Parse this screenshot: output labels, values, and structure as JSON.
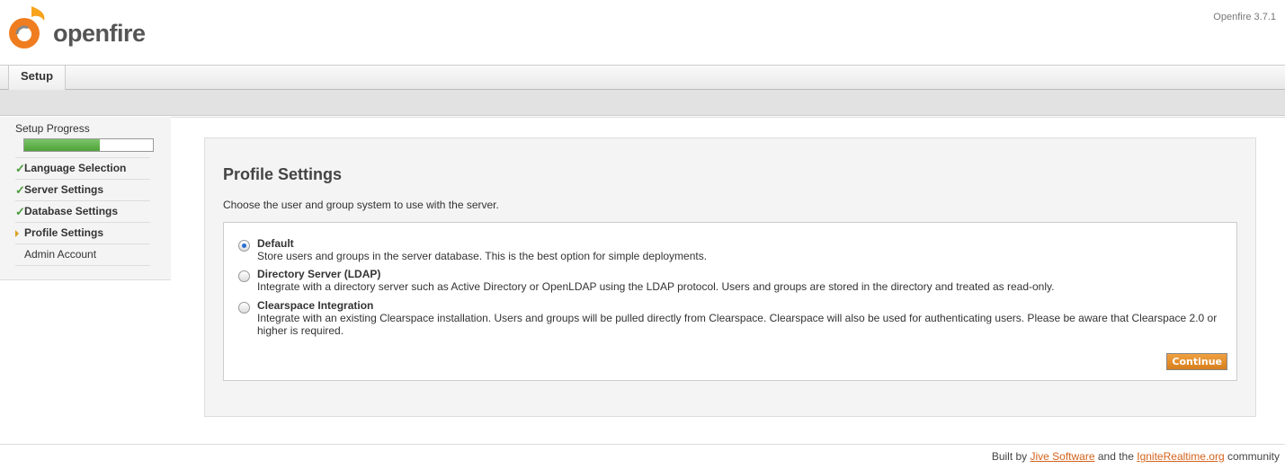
{
  "header": {
    "logo_text": "openfire",
    "version": "Openfire 3.7.1"
  },
  "tabs": [
    {
      "label": "Setup"
    }
  ],
  "sidebar": {
    "title": "Setup Progress",
    "progress_percent": 59,
    "items": [
      {
        "label": "Language Selection",
        "status": "done"
      },
      {
        "label": "Server Settings",
        "status": "done"
      },
      {
        "label": "Database Settings",
        "status": "done"
      },
      {
        "label": "Profile Settings",
        "status": "current"
      },
      {
        "label": "Admin Account",
        "status": "pending"
      }
    ]
  },
  "main": {
    "title": "Profile Settings",
    "intro": "Choose the user and group system to use with the server.",
    "options": [
      {
        "label": "Default",
        "description": "Store users and groups in the server database. This is the best option for simple deployments.",
        "selected": true
      },
      {
        "label": "Directory Server (LDAP)",
        "description": "Integrate with a directory server such as Active Directory or OpenLDAP using the LDAP protocol. Users and groups are stored in the directory and treated as read-only.",
        "selected": false
      },
      {
        "label": "Clearspace Integration",
        "description": "Integrate with an existing Clearspace installation. Users and groups will be pulled directly from Clearspace. Clearspace will also be used for authenticating users. Please be aware that Clearspace 2.0 or higher is required.",
        "selected": false
      }
    ],
    "continue_label": "Continue"
  },
  "footer": {
    "prefix": "Built by ",
    "link1": "Jive Software",
    "middle": " and the ",
    "link2": "IgniteRealtime.org",
    "suffix": " community"
  },
  "colors": {
    "accent": "#e8892a",
    "link": "#d4631c",
    "progress": "#5cae48"
  }
}
